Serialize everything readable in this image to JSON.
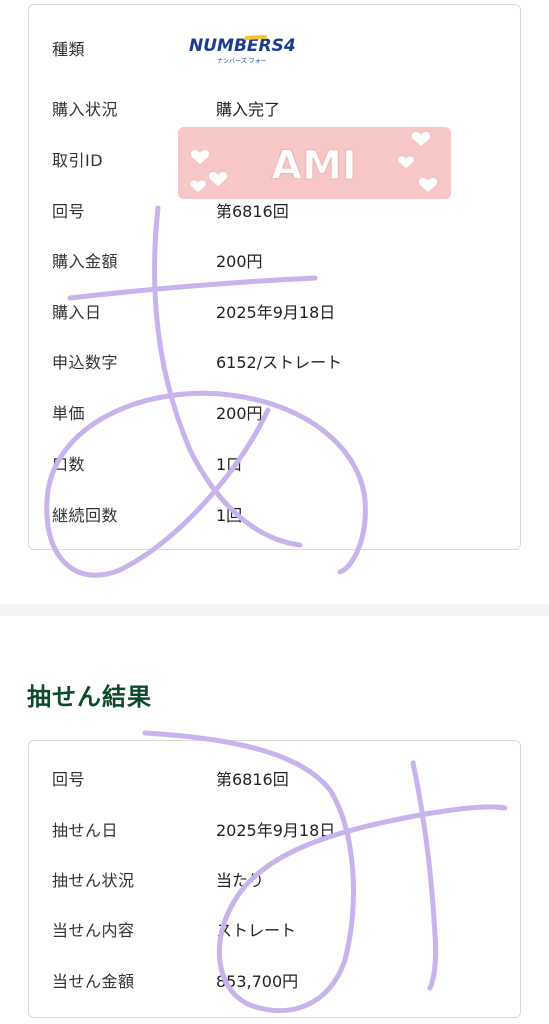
{
  "purchase": {
    "rows": [
      {
        "label": "種類",
        "value": ""
      },
      {
        "label": "購入状況",
        "value": "購入完了"
      },
      {
        "label": "取引ID",
        "value": ""
      },
      {
        "label": "回号",
        "value": "第6816回"
      },
      {
        "label": "購入金額",
        "value": "200円"
      },
      {
        "label": "購入日",
        "value": "2025年9月18日"
      },
      {
        "label": "申込数字",
        "value": "6152/ストレート"
      },
      {
        "label": "単価",
        "value": "200円"
      },
      {
        "label": "口数",
        "value": "1口"
      },
      {
        "label": "継続回数",
        "value": "1回"
      }
    ],
    "logo_text": "NUMBERS4",
    "logo_sub": "ナンバーズ フォー"
  },
  "sticker": {
    "text": "AMI",
    "color": "#f7c6c6"
  },
  "result": {
    "title": "抽せん結果",
    "rows": [
      {
        "label": "回号",
        "value": "第6816回"
      },
      {
        "label": "抽せん日",
        "value": "2025年9月18日"
      },
      {
        "label": "抽せん状況",
        "value": "当たり"
      },
      {
        "label": "当せん内容",
        "value": "ストレート"
      },
      {
        "label": "当せん金額",
        "value": "853,700円"
      }
    ]
  },
  "colors": {
    "accent": "#0d4a2c",
    "scribble": "#c9b3ec",
    "logo_blue": "#1a3d8f",
    "logo_green": "#2aa34a"
  }
}
